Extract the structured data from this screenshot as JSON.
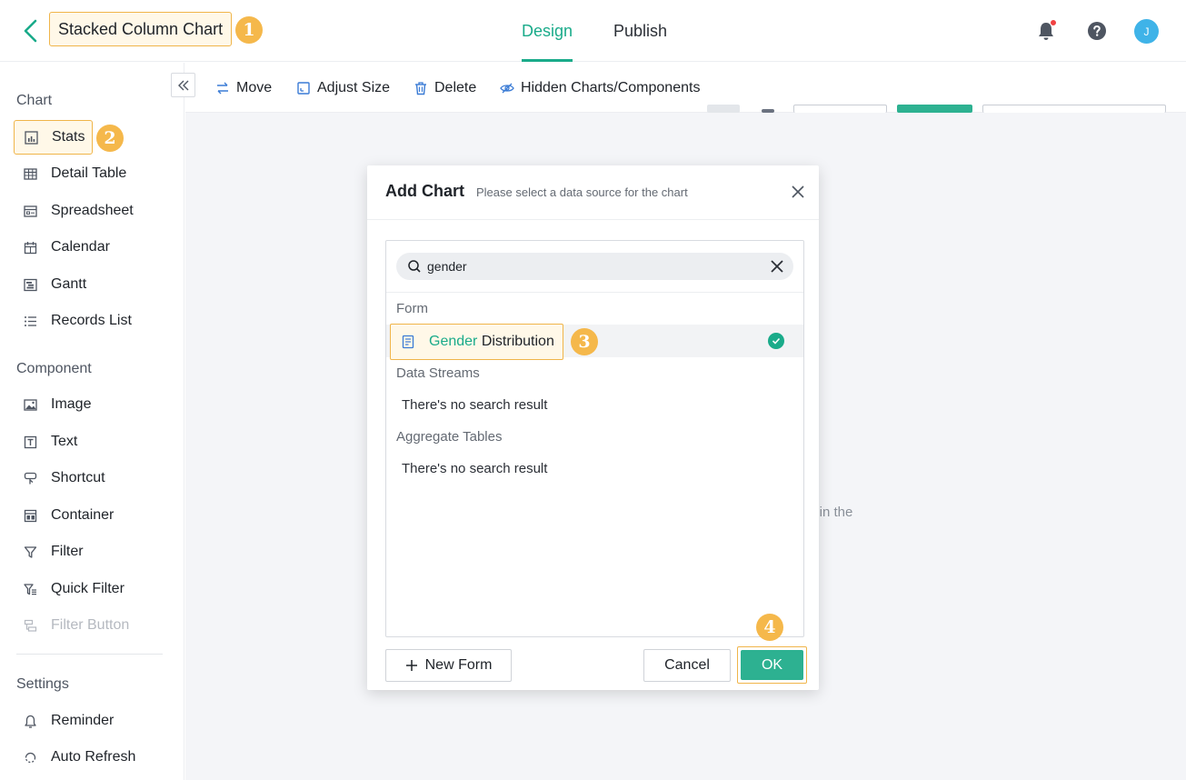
{
  "header": {
    "title": "Stacked Column Chart",
    "tabs": [
      {
        "label": "Design",
        "active": true
      },
      {
        "label": "Publish",
        "active": false
      }
    ],
    "avatar_initial": "J",
    "accent_color": "#1aab8a"
  },
  "badges": [
    "1",
    "2",
    "3",
    "4"
  ],
  "sidebar": {
    "sections": {
      "chart": "Chart",
      "component": "Component",
      "settings": "Settings"
    },
    "chart_items": [
      "Stats",
      "Detail Table",
      "Spreadsheet",
      "Calendar",
      "Gantt",
      "Records List"
    ],
    "component_items": [
      "Image",
      "Text",
      "Shortcut",
      "Container",
      "Filter",
      "Quick Filter",
      "Filter Button"
    ],
    "settings_items": [
      "Reminder",
      "Auto Refresh"
    ]
  },
  "toolbar": {
    "move": "Move",
    "adjust_size": "Adjust Size",
    "delete": "Delete",
    "hidden": "Hidden Charts/Components"
  },
  "canvas": {
    "hint_fragment": "nt in the"
  },
  "modal": {
    "title": "Add Chart",
    "subtitle": "Please select a data source for the chart",
    "search_value": "gender",
    "groups": {
      "form": "Form",
      "data_streams": "Data Streams",
      "aggregate_tables": "Aggregate Tables"
    },
    "selected_item": {
      "highlight": "Gender",
      "rest": " Distribution"
    },
    "empty_text": "There's no search result",
    "new_form": "New Form",
    "cancel": "Cancel",
    "ok": "OK"
  }
}
